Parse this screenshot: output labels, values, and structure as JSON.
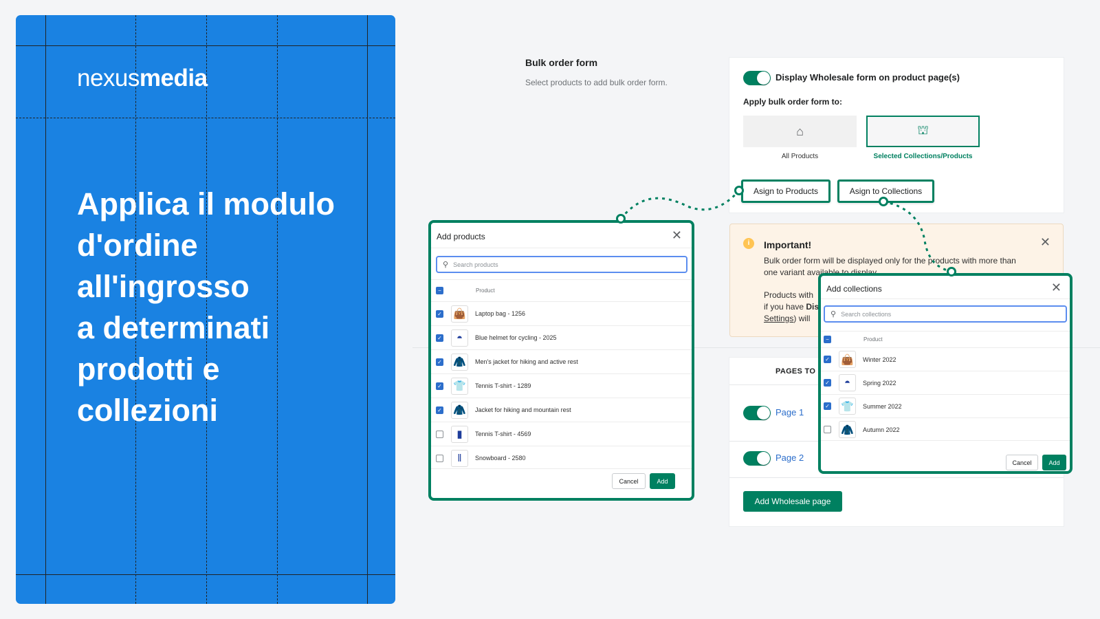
{
  "brand": {
    "logo_light": "nexus",
    "logo_bold": "media",
    "color": "#1a82e2"
  },
  "headline": "Applica il modulo\nd'ordine\nall'ingrosso\na determinati\nprodotti e\ncollezioni",
  "section": {
    "title": "Bulk order form",
    "subtitle": "Select products to add bulk order form."
  },
  "settings": {
    "display_toggle_label": "Display Wholesale form on product page(s)",
    "display_toggle_on": true,
    "apply_label": "Apply bulk order form to:",
    "options": [
      {
        "label": "All Products",
        "icon": "store-add-icon",
        "selected": false
      },
      {
        "label": "Selected Collections/Products",
        "icon": "collections-icon",
        "selected": true
      }
    ],
    "assign_products": "Asign to Products",
    "assign_collections": "Asign to Collections"
  },
  "alert": {
    "title": "Important!",
    "line1": "Bulk order form will be displayed only for the products with more than",
    "line2": "one variant available to display.",
    "line3": "Products with",
    "line4_a": "if you have ",
    "line4_b": "Dis",
    "line5_link": "Settings",
    "line5_rest": ") will"
  },
  "pages": {
    "header": "PAGES TO S",
    "items": [
      {
        "label": "Page 1",
        "on": true
      },
      {
        "label": "Page 2",
        "on": true
      }
    ],
    "add_button": "Add Wholesale page"
  },
  "add_products": {
    "title": "Add products",
    "search_placeholder": "Search products",
    "column": "Product",
    "cancel": "Cancel",
    "add": "Add",
    "rows": [
      {
        "name": "Laptop bag - 1256",
        "checked": true,
        "icon": "bag-icon"
      },
      {
        "name": "Blue helmet for cycling - 2025",
        "checked": true,
        "icon": "helmet-icon"
      },
      {
        "name": "Men's jacket for hiking and active rest",
        "checked": true,
        "icon": "jacket-icon"
      },
      {
        "name": "Tennis T-shirt - 1289",
        "checked": true,
        "icon": "tshirt-icon"
      },
      {
        "name": "Jacket for hiking and mountain rest",
        "checked": true,
        "icon": "jacket-icon"
      },
      {
        "name": "Tennis T-shirt - 4569",
        "checked": false,
        "icon": "tank-top-icon"
      },
      {
        "name": "Snowboard - 2580",
        "checked": false,
        "icon": "snowboard-icon"
      }
    ]
  },
  "add_collections": {
    "title": "Add collections",
    "search_placeholder": "Search collections",
    "column": "Product",
    "cancel": "Cancel",
    "add": "Add",
    "rows": [
      {
        "name": "Winter 2022",
        "checked": true,
        "icon": "bag-icon"
      },
      {
        "name": "Spring 2022",
        "checked": true,
        "icon": "helmet-icon"
      },
      {
        "name": "Summer 2022",
        "checked": true,
        "icon": "tshirt-icon"
      },
      {
        "name": "Autumn 2022",
        "checked": false,
        "icon": "jacket-icon"
      }
    ]
  },
  "accent": "#008060"
}
